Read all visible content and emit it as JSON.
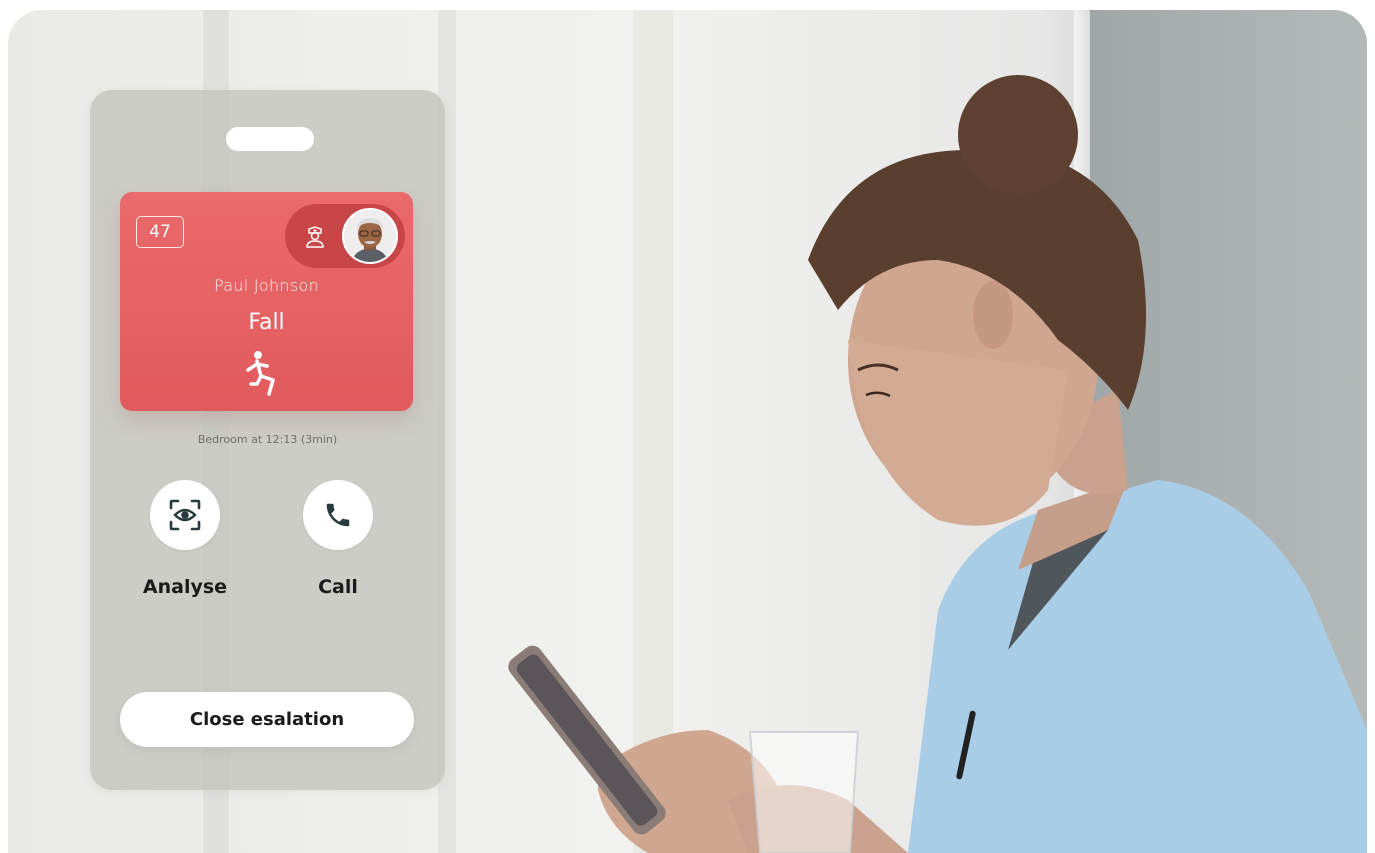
{
  "panel": {
    "room_number": "47",
    "patient_name": "Paul Johnson",
    "alert_type": "Fall",
    "event_meta": "Bedroom at 12:13 (3min)",
    "actions": [
      {
        "label": "Analyse",
        "icon": "eye-scan-icon"
      },
      {
        "label": "Call",
        "icon": "phone-icon"
      }
    ],
    "close_label": "Close esalation"
  },
  "colors": {
    "alert_red": "#e15a5d",
    "staff_pill_red": "#c84548",
    "panel_bg": "#c4c6be",
    "button_bg": "#ffffff",
    "icon_dark": "#273a3e"
  }
}
